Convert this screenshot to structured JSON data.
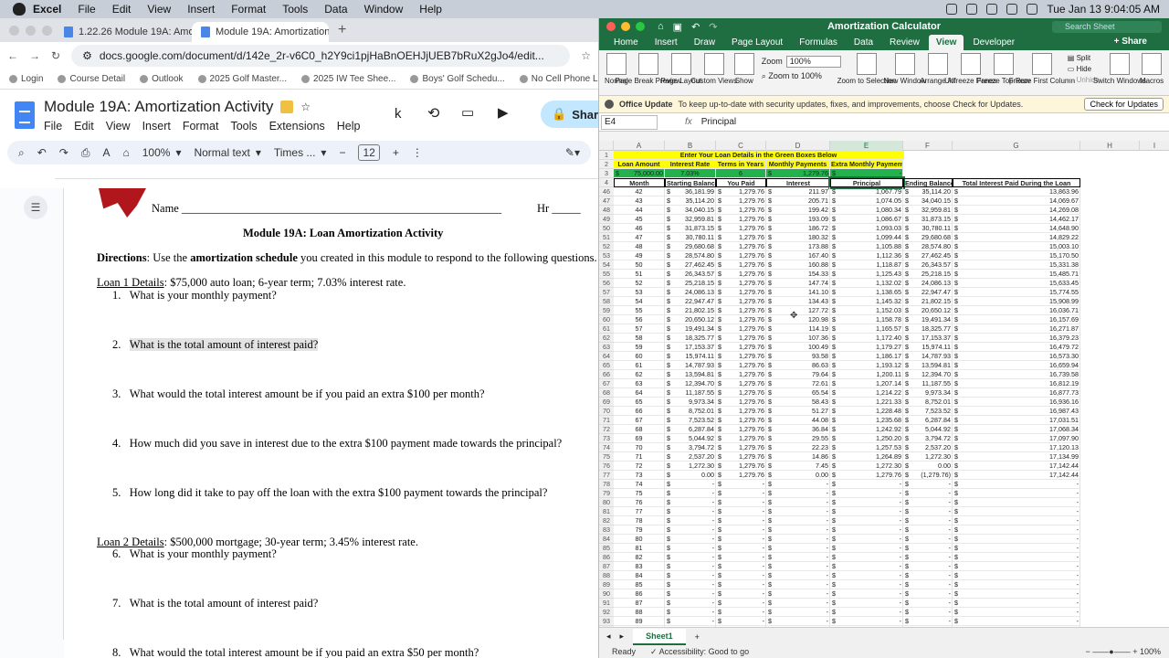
{
  "menubar": {
    "app": "Excel",
    "items": [
      "File",
      "Edit",
      "View",
      "Insert",
      "Format",
      "Tools",
      "Data",
      "Window",
      "Help"
    ],
    "datetime": "Tue Jan 13  9:04:05 AM"
  },
  "browser": {
    "tabs": [
      {
        "label": "1.22.26 Module 19A: Amortiz"
      },
      {
        "label": "Module 19A: Amortization Ac"
      }
    ],
    "url": "docs.google.com/document/d/142e_2r-v6C0_h2Y9ci1pjHaBnOEHJjUEB7bRuX2gJo4/edit...",
    "bookmarks": [
      "Login",
      "Course Detail",
      "Outlook",
      "2025 Golf Master...",
      "2025 IW Tee Shee...",
      "Boys' Golf Schedu...",
      "No Cell Phone List..."
    ]
  },
  "docs": {
    "title": "Module 19A: Amortization Activity",
    "menu": [
      "File",
      "Edit",
      "View",
      "Insert",
      "Format",
      "Tools",
      "Extensions",
      "Help"
    ],
    "share": "Share",
    "toolbar": {
      "zoom": "100%",
      "style": "Normal text",
      "font": "Times ...",
      "size": "12"
    },
    "name_label": "Name",
    "hr_label": "Hr",
    "heading": "Module 19A: Loan Amortization Activity",
    "directions_label": "Directions",
    "directions_a": ": Use the ",
    "directions_b": "amortization schedule",
    "directions_c": " you created in this module to respond to the following questions.",
    "loan1_label": "Loan 1 Details",
    "loan1_text": ": $75,000 auto loan; 6-year term; 7.03% interest rate.",
    "loan2_label": "Loan 2 Details",
    "loan2_text": ": $500,000 mortgage; 30-year term; 3.45% interest rate.",
    "questions": [
      {
        "num": "1.",
        "text": "What is your monthly payment?"
      },
      {
        "num": "2.",
        "text": "What is the total amount of interest paid?"
      },
      {
        "num": "3.",
        "text": "What would the total interest amount be if you paid an extra $100 per month?"
      },
      {
        "num": "4.",
        "text": "How much did you save in interest due to the extra $100 payment made towards the principal?"
      },
      {
        "num": "5.",
        "text": "How long did it take to pay off the loan with the extra $100 payment towards the principal?"
      },
      {
        "num": "6.",
        "text": "What is your monthly payment?"
      },
      {
        "num": "7.",
        "text": "What is the total amount of interest paid?"
      },
      {
        "num": "8.",
        "text": "What would the total interest amount be if you paid an extra $50 per month?"
      }
    ]
  },
  "excel": {
    "title": "Amortization Calculator",
    "search_placeholder": "Search Sheet",
    "tabs": [
      "Home",
      "Insert",
      "Draw",
      "Page Layout",
      "Formulas",
      "Data",
      "Review",
      "View",
      "Developer"
    ],
    "share": "Share",
    "ribbon": {
      "buttons": [
        "Normal",
        "Page Break Preview",
        "Page Layout",
        "Custom Views",
        "Show"
      ],
      "zoom_label": "Zoom",
      "zoom_value": "100%",
      "zoom_100": "Zoom to 100%",
      "buttons2": [
        "Zoom to Selection",
        "New Window",
        "Arrange All",
        "Unfreeze Panes",
        "Freeze Top Row",
        "Freeze First Column"
      ],
      "split": "Split",
      "hide": "Hide",
      "unhide": "Unhide",
      "buttons3": [
        "Switch Windows",
        "Macros"
      ]
    },
    "office_update_title": "Office Update",
    "office_update_text": "To keep up-to-date with security updates, fixes, and improvements, choose Check for Updates.",
    "office_update_btn": "Check for Updates",
    "namebox": "E4",
    "formula": "Principal",
    "columns": [
      "A",
      "B",
      "C",
      "D",
      "E",
      "F",
      "G",
      "H",
      "I"
    ],
    "banner": "Enter Your Loan Details in the Green Boxes Below",
    "input_headers": [
      "Loan Amount",
      "Interest Rate",
      "Terms in Years",
      "Monthly Payments",
      "Extra Monthly Payment"
    ],
    "inputs": [
      "75,000.00",
      "7.03%",
      "6",
      "1,279.76",
      "-"
    ],
    "table_headers": [
      "Month",
      "Starting Balance",
      "You Paid",
      "Interest",
      "Principal",
      "Ending Balance",
      "Total Interest Paid During the Loan"
    ],
    "rows": [
      [
        "46",
        "42",
        "36,181.99",
        "1,279.76",
        "211.97",
        "1,067.79",
        "35,114.20",
        "13,863.96"
      ],
      [
        "47",
        "43",
        "35,114.20",
        "1,279.76",
        "205.71",
        "1,074.05",
        "34,040.15",
        "14,069.67"
      ],
      [
        "48",
        "44",
        "34,040.15",
        "1,279.76",
        "199.42",
        "1,080.34",
        "32,959.81",
        "14,269.08"
      ],
      [
        "49",
        "45",
        "32,959.81",
        "1,279.76",
        "193.09",
        "1,086.67",
        "31,873.15",
        "14,462.17"
      ],
      [
        "50",
        "46",
        "31,873.15",
        "1,279.76",
        "186.72",
        "1,093.03",
        "30,780.11",
        "14,648.90"
      ],
      [
        "51",
        "47",
        "30,780.11",
        "1,279.76",
        "180.32",
        "1,099.44",
        "29,680.68",
        "14,829.22"
      ],
      [
        "52",
        "48",
        "29,680.68",
        "1,279.76",
        "173.88",
        "1,105.88",
        "28,574.80",
        "15,003.10"
      ],
      [
        "53",
        "49",
        "28,574.80",
        "1,279.76",
        "167.40",
        "1,112.36",
        "27,462.45",
        "15,170.50"
      ],
      [
        "54",
        "50",
        "27,462.45",
        "1,279.76",
        "160.88",
        "1,118.87",
        "26,343.57",
        "15,331.38"
      ],
      [
        "55",
        "51",
        "26,343.57",
        "1,279.76",
        "154.33",
        "1,125.43",
        "25,218.15",
        "15,485.71"
      ],
      [
        "56",
        "52",
        "25,218.15",
        "1,279.76",
        "147.74",
        "1,132.02",
        "24,086.13",
        "15,633.45"
      ],
      [
        "57",
        "53",
        "24,086.13",
        "1,279.76",
        "141.10",
        "1,138.65",
        "22,947.47",
        "15,774.55"
      ],
      [
        "58",
        "54",
        "22,947.47",
        "1,279.76",
        "134.43",
        "1,145.32",
        "21,802.15",
        "15,908.99"
      ],
      [
        "59",
        "55",
        "21,802.15",
        "1,279.76",
        "127.72",
        "1,152.03",
        "20,650.12",
        "16,036.71"
      ],
      [
        "60",
        "56",
        "20,650.12",
        "1,279.76",
        "120.98",
        "1,158.78",
        "19,491.34",
        "16,157.69"
      ],
      [
        "61",
        "57",
        "19,491.34",
        "1,279.76",
        "114.19",
        "1,165.57",
        "18,325.77",
        "16,271.87"
      ],
      [
        "62",
        "58",
        "18,325.77",
        "1,279.76",
        "107.36",
        "1,172.40",
        "17,153.37",
        "16,379.23"
      ],
      [
        "63",
        "59",
        "17,153.37",
        "1,279.76",
        "100.49",
        "1,179.27",
        "15,974.11",
        "16,479.72"
      ],
      [
        "64",
        "60",
        "15,974.11",
        "1,279.76",
        "93.58",
        "1,186.17",
        "14,787.93",
        "16,573.30"
      ],
      [
        "65",
        "61",
        "14,787.93",
        "1,279.76",
        "86.63",
        "1,193.12",
        "13,594.81",
        "16,659.94"
      ],
      [
        "66",
        "62",
        "13,594.81",
        "1,279.76",
        "79.64",
        "1,200.11",
        "12,394.70",
        "16,739.58"
      ],
      [
        "67",
        "63",
        "12,394.70",
        "1,279.76",
        "72.61",
        "1,207.14",
        "11,187.55",
        "16,812.19"
      ],
      [
        "68",
        "64",
        "11,187.55",
        "1,279.76",
        "65.54",
        "1,214.22",
        "9,973.34",
        "16,877.73"
      ],
      [
        "69",
        "65",
        "9,973.34",
        "1,279.76",
        "58.43",
        "1,221.33",
        "8,752.01",
        "16,936.16"
      ],
      [
        "70",
        "66",
        "8,752.01",
        "1,279.76",
        "51.27",
        "1,228.48",
        "7,523.52",
        "16,987.43"
      ],
      [
        "71",
        "67",
        "7,523.52",
        "1,279.76",
        "44.08",
        "1,235.68",
        "6,287.84",
        "17,031.51"
      ],
      [
        "72",
        "68",
        "6,287.84",
        "1,279.76",
        "36.84",
        "1,242.92",
        "5,044.92",
        "17,068.34"
      ],
      [
        "73",
        "69",
        "5,044.92",
        "1,279.76",
        "29.55",
        "1,250.20",
        "3,794.72",
        "17,097.90"
      ],
      [
        "74",
        "70",
        "3,794.72",
        "1,279.76",
        "22.23",
        "1,257.53",
        "2,537.20",
        "17,120.13"
      ],
      [
        "75",
        "71",
        "2,537.20",
        "1,279.76",
        "14.86",
        "1,264.89",
        "1,272.30",
        "17,134.99"
      ],
      [
        "76",
        "72",
        "1,272.30",
        "1,279.76",
        "7.45",
        "1,272.30",
        "0.00",
        "17,142.44"
      ],
      [
        "77",
        "73",
        "0.00",
        "1,279.76",
        "0.00",
        "1,279.76",
        "(1,279.76)",
        "17,142.44"
      ]
    ],
    "empty_rows": [
      [
        "78",
        "74"
      ],
      [
        "79",
        "75"
      ],
      [
        "80",
        "76"
      ],
      [
        "81",
        "77"
      ],
      [
        "82",
        "78"
      ],
      [
        "83",
        "79"
      ],
      [
        "84",
        "80"
      ],
      [
        "85",
        "81"
      ],
      [
        "86",
        "82"
      ],
      [
        "87",
        "83"
      ],
      [
        "88",
        "84"
      ],
      [
        "89",
        "85"
      ],
      [
        "90",
        "86"
      ],
      [
        "91",
        "87"
      ],
      [
        "92",
        "88"
      ],
      [
        "93",
        "89"
      ],
      [
        "94",
        "90"
      ]
    ],
    "dash": "-",
    "dollar": "$",
    "sheet_tab": "Sheet1",
    "status_ready": "Ready",
    "status_access": "Accessibility: Good to go",
    "zoom_status": "100%"
  }
}
